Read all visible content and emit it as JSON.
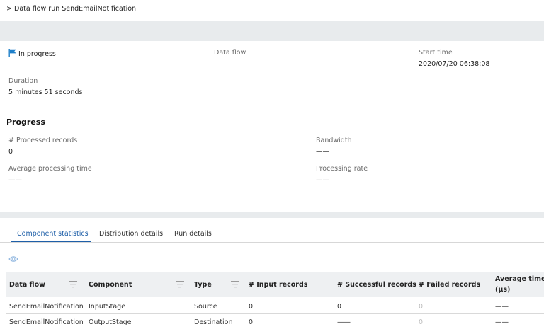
{
  "breadcrumb": {
    "chevron": ">",
    "text": "Data flow run SendEmailNotification"
  },
  "colors": {
    "accent": "#1e5fa8",
    "flag": "#1e7fc9",
    "band": "#e8ebed"
  },
  "summary": {
    "status": "In progress",
    "status_icon": "flag-icon",
    "data_flow_label": "Data flow",
    "start_time_label": "Start time",
    "start_time_value": "2020/07/20 06:38:08",
    "duration_label": "Duration",
    "duration_value": "5 minutes 51 seconds"
  },
  "progress": {
    "title": "Progress",
    "processed_label": "# Processed records",
    "processed_value": "0",
    "bandwidth_label": "Bandwidth",
    "bandwidth_value": "——",
    "avg_time_label": "Average processing time",
    "avg_time_value": "——",
    "rate_label": "Processing rate",
    "rate_value": "——"
  },
  "tabs": [
    {
      "label": "Component statistics",
      "active": true
    },
    {
      "label": "Distribution details",
      "active": false
    },
    {
      "label": "Run details",
      "active": false
    }
  ],
  "table": {
    "visibility_icon": "eye-icon",
    "headers": {
      "data_flow": "Data flow",
      "component": "Component",
      "type": "Type",
      "input": "# Input records",
      "successful": "# Successful records",
      "failed": "# Failed records",
      "avg_line1": "Average time",
      "avg_line2": "(μs)"
    },
    "rows": [
      {
        "data_flow": "SendEmailNotification",
        "component": "InputStage",
        "type": "Source",
        "input": "0",
        "successful": "0",
        "failed": "0",
        "avg": "——"
      },
      {
        "data_flow": "SendEmailNotification",
        "component": "OutputStage",
        "type": "Destination",
        "input": "0",
        "successful": "——",
        "failed": "0",
        "avg": "——"
      }
    ]
  }
}
